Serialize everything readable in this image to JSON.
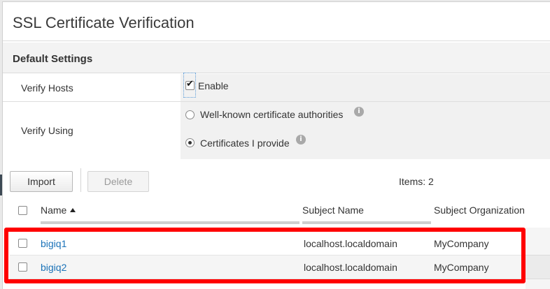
{
  "dialog": {
    "title": "SSL Certificate Verification"
  },
  "default_settings": {
    "section_title": "Default Settings",
    "verify_hosts": {
      "label": "Verify Hosts",
      "checkbox_label": "Enable",
      "checked": true
    },
    "verify_using": {
      "label": "Verify Using",
      "options": [
        {
          "label": "Well-known certificate authorities",
          "selected": false,
          "icon": "info-icon"
        },
        {
          "label": "Certificates I provide",
          "selected": true,
          "icon": "info-icon"
        }
      ]
    }
  },
  "toolbar": {
    "import_label": "Import",
    "delete_label": "Delete",
    "items_count": "Items: 2"
  },
  "grid": {
    "columns": [
      {
        "label": "Name",
        "sort": "ascending"
      },
      {
        "label": "Subject Name"
      },
      {
        "label": "Subject Organization"
      }
    ],
    "rows": [
      {
        "name": "bigiq1",
        "subject_name": "localhost.localdomain",
        "subject_organization": "MyCompany"
      },
      {
        "name": "bigiq2",
        "subject_name": "localhost.localdomain",
        "subject_organization": "MyCompany"
      }
    ]
  },
  "colors": {
    "link": "#1a72b8",
    "highlight": "#ff0000"
  }
}
